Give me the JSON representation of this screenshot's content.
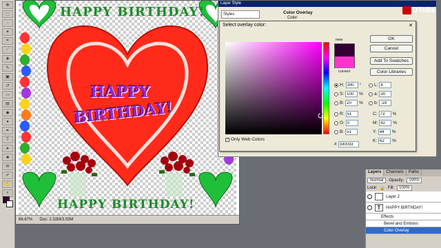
{
  "document": {
    "zoom": "66.67%",
    "doc_info": "Doc: 2.32M/3.03M",
    "top_text": "HAPPY BIRTHDAY!",
    "bottom_text": "HAPPY BIRTHDAY!",
    "heart_line1": "HAPPY",
    "heart_line2": "BIRTHDAY!"
  },
  "layer_style": {
    "title": "Layer Style",
    "styles_label": "Styles",
    "section": "Color Overlay",
    "sub": "Color"
  },
  "picker": {
    "title": "Select overlay color:",
    "new_label": "new",
    "current_label": "current",
    "ok": "OK",
    "cancel": "Cancel",
    "add_swatches": "Add To Swatches",
    "color_libraries": "Color Libraries",
    "only_web_colors": "Only Web Colors",
    "new_color": "#330033",
    "current_color": "#ff33cc",
    "fields": {
      "H": "300",
      "H_unit": "°",
      "S": "100",
      "S_unit": "%",
      "B": "20",
      "B_unit": "%",
      "R": "51",
      "G": "0",
      "Bl": "51",
      "L": "8",
      "a": "30",
      "b": "-19",
      "C": "73",
      "C_unit": "%",
      "M": "92",
      "M_unit": "%",
      "Y": "44",
      "Y_unit": "%",
      "K": "62",
      "K_unit": "%",
      "hex_label": "#",
      "hex": "330033"
    }
  },
  "layers": {
    "tabs": [
      "Layers",
      "Channels",
      "Paths"
    ],
    "mode": "Normal",
    "opacity_label": "Opacity:",
    "opacity": "100%",
    "lock_label": "Lock:",
    "fill_label": "Fill:",
    "fill": "100%",
    "rows": [
      "Layer 2",
      "HAPPY BIRTHDAY!",
      "Effects",
      "Bevel and Emboss",
      "Color Overlay"
    ]
  },
  "watermark": "DTube"
}
